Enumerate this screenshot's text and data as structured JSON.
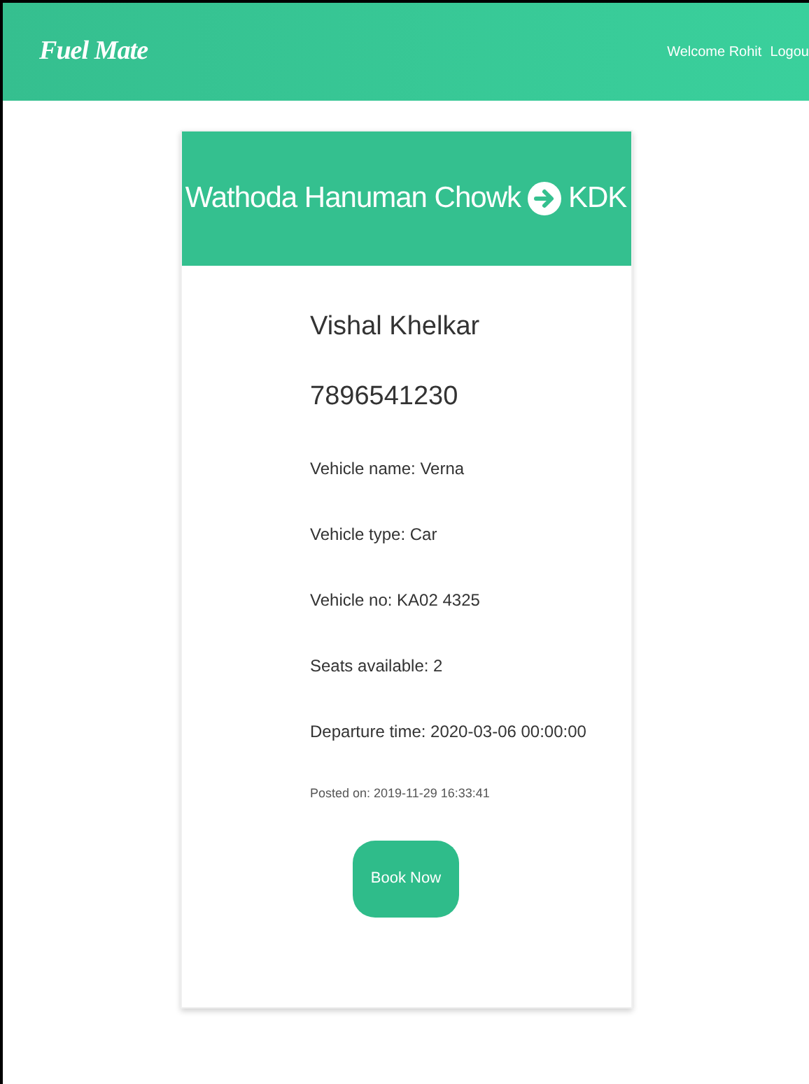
{
  "navbar": {
    "logo": "Fuel Mate",
    "welcome": "Welcome Rohit",
    "logout": "Logou"
  },
  "ride": {
    "from": "Wathoda Hanuman Chowk",
    "to": "KDK",
    "driver": "Vishal Khelkar",
    "phone": "7896541230",
    "details": [
      "Vehicle name: Verna",
      "Vehicle type: Car",
      "Vehicle no: KA02 4325",
      "Seats available: 2",
      "Departure time: 2020-03-06 00:00:00"
    ],
    "posted": "Posted on: 2019-11-29 16:33:41",
    "button": "Book Now"
  }
}
